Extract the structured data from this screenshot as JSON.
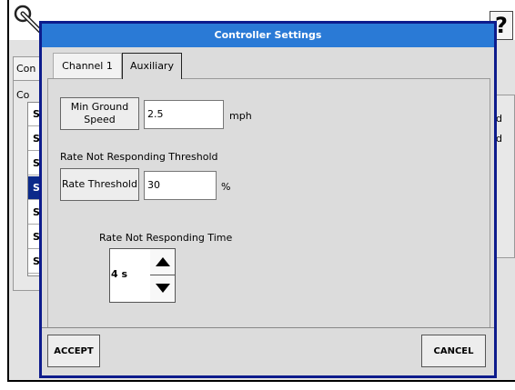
{
  "background": {
    "help_label": "?",
    "tab_label": "Con",
    "panel_label": "Co",
    "list_items": [
      "S",
      "S",
      "S",
      "S",
      "S",
      "S",
      "S"
    ],
    "selected_index": 3,
    "right_items": [
      "d",
      "d"
    ]
  },
  "dialog": {
    "title": "Controller Settings",
    "tabs": [
      {
        "label": "Channel 1",
        "active": false
      },
      {
        "label": "Auxiliary",
        "active": true
      }
    ],
    "min_ground_speed": {
      "button_label": "Min Ground Speed",
      "value": "2.5",
      "unit": "mph"
    },
    "rate_threshold_section_label": "Rate Not Responding Threshold",
    "rate_threshold": {
      "button_label": "Rate Threshold",
      "value": "30",
      "unit": "%"
    },
    "rate_time_section_label": "Rate Not Responding Time",
    "rate_time_value": "4 s",
    "accept_label": "ACCEPT",
    "cancel_label": "CANCEL"
  },
  "colors": {
    "title_bar": "#2a7ad6",
    "dialog_border": "#0d1b8c",
    "selected_row": "#0c2a8a"
  }
}
